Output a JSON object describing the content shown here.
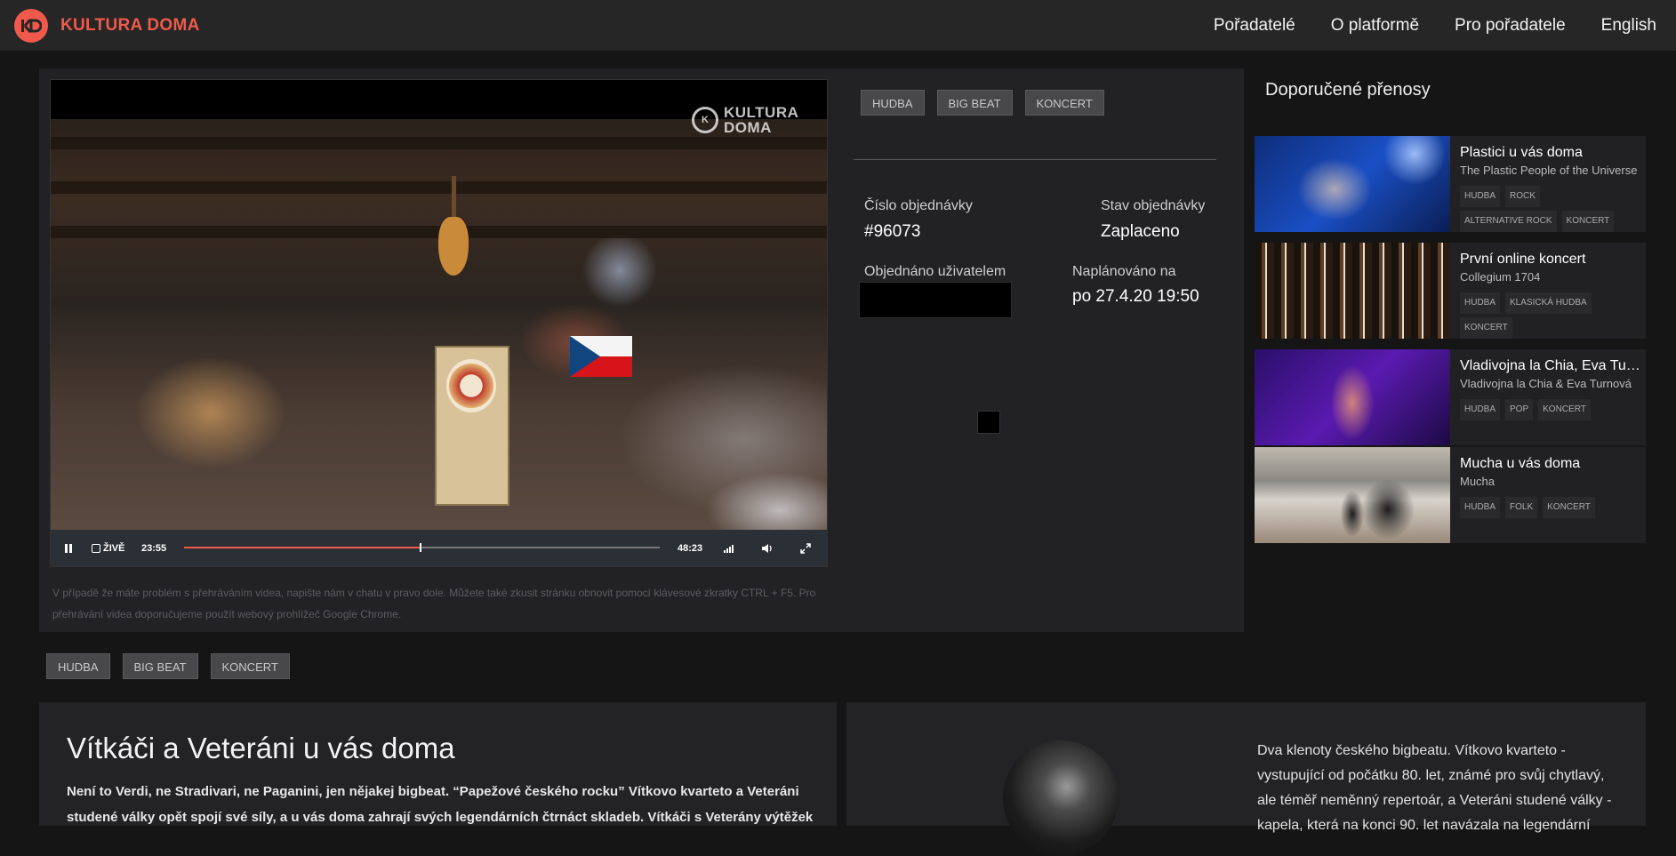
{
  "header": {
    "logo_mark": "K",
    "brand": "KULTURA DOMA",
    "nav": [
      "Pořadatelé",
      "O platformě",
      "Pro pořadatele",
      "English"
    ]
  },
  "player": {
    "watermark": "KULTURA DOMA",
    "live_label": "ŽIVĚ",
    "current_time": "23:55",
    "duration": "48:23",
    "progress": 0.495,
    "help_text": "V případě že máte problém s přehráváním videa, napište nám v chatu v pravo dole. Můžete také zkusit stránku obnovit pomocí klávesové zkratky CTRL + F5. Pro přehrávání videa doporučujeme použít webový prohlížeč Google Chrome."
  },
  "tags": [
    "HUDBA",
    "BIG BEAT",
    "KONCERT"
  ],
  "order": {
    "number_label": "Číslo objednávky",
    "number": "#96073",
    "status_label": "Stav objednávky",
    "status": "Zaplaceno",
    "user_label": "Objednáno uživatelem",
    "scheduled_label": "Naplánováno na",
    "scheduled": "po 27.4.20 19:50"
  },
  "recommended": {
    "title": "Doporučené přenosy",
    "items": [
      {
        "name": "Plastici u vás doma",
        "sub": "The Plastic People of the Universe",
        "tags": [
          "HUDBA",
          "ROCK",
          "ALTERNATIVE ROCK",
          "KONCERT"
        ]
      },
      {
        "name": "První online koncert",
        "sub": "Collegium 1704",
        "tags": [
          "HUDBA",
          "KLASICKÁ HUDBA",
          "KONCERT"
        ]
      },
      {
        "name": "Vladivojna la Chia, Eva Turnová",
        "sub": "Vladivojna la Chia & Eva Turnová",
        "tags": [
          "HUDBA",
          "POP",
          "KONCERT"
        ]
      },
      {
        "name": "Mucha u vás doma",
        "sub": "Mucha",
        "tags": [
          "HUDBA",
          "FOLK",
          "KONCERT"
        ]
      }
    ]
  },
  "event": {
    "title": "Vítkáči a Veteráni u vás doma",
    "description": "Není to Verdi, ne Stradivari, ne Paganini, jen nějakej bigbeat. “Papežové českého rocku” Vítkovo kvarteto a Veteráni studené války opět spojí své síly, a u vás doma zahrají svých legendárních čtrnáct skladeb. Vítkáči s Veterány výtěžek",
    "side_description": "Dva klenoty českého bigbeatu. Vítkovo kvarteto - vystupující od počátku 80. let, známé pro svůj chytlavý, ale téměř neměnný repertoár, a Veteráni studené války - kapela, která na konci 90. let navázala na legendární"
  },
  "colors": {
    "accent": "#f05a4c",
    "background": "#151515",
    "panel": "#222225"
  }
}
